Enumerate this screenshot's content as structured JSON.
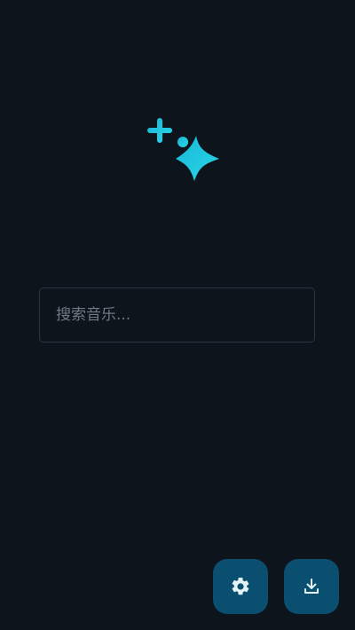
{
  "app": {
    "logo_icon": "sparkles-icon",
    "accent_color": "#22c6df"
  },
  "search": {
    "placeholder": "搜索音乐...",
    "value": ""
  },
  "actions": {
    "settings_icon": "gear-icon",
    "download_icon": "download-icon",
    "button_color": "#0a4f6f",
    "icon_color": "#e3f2f8"
  }
}
